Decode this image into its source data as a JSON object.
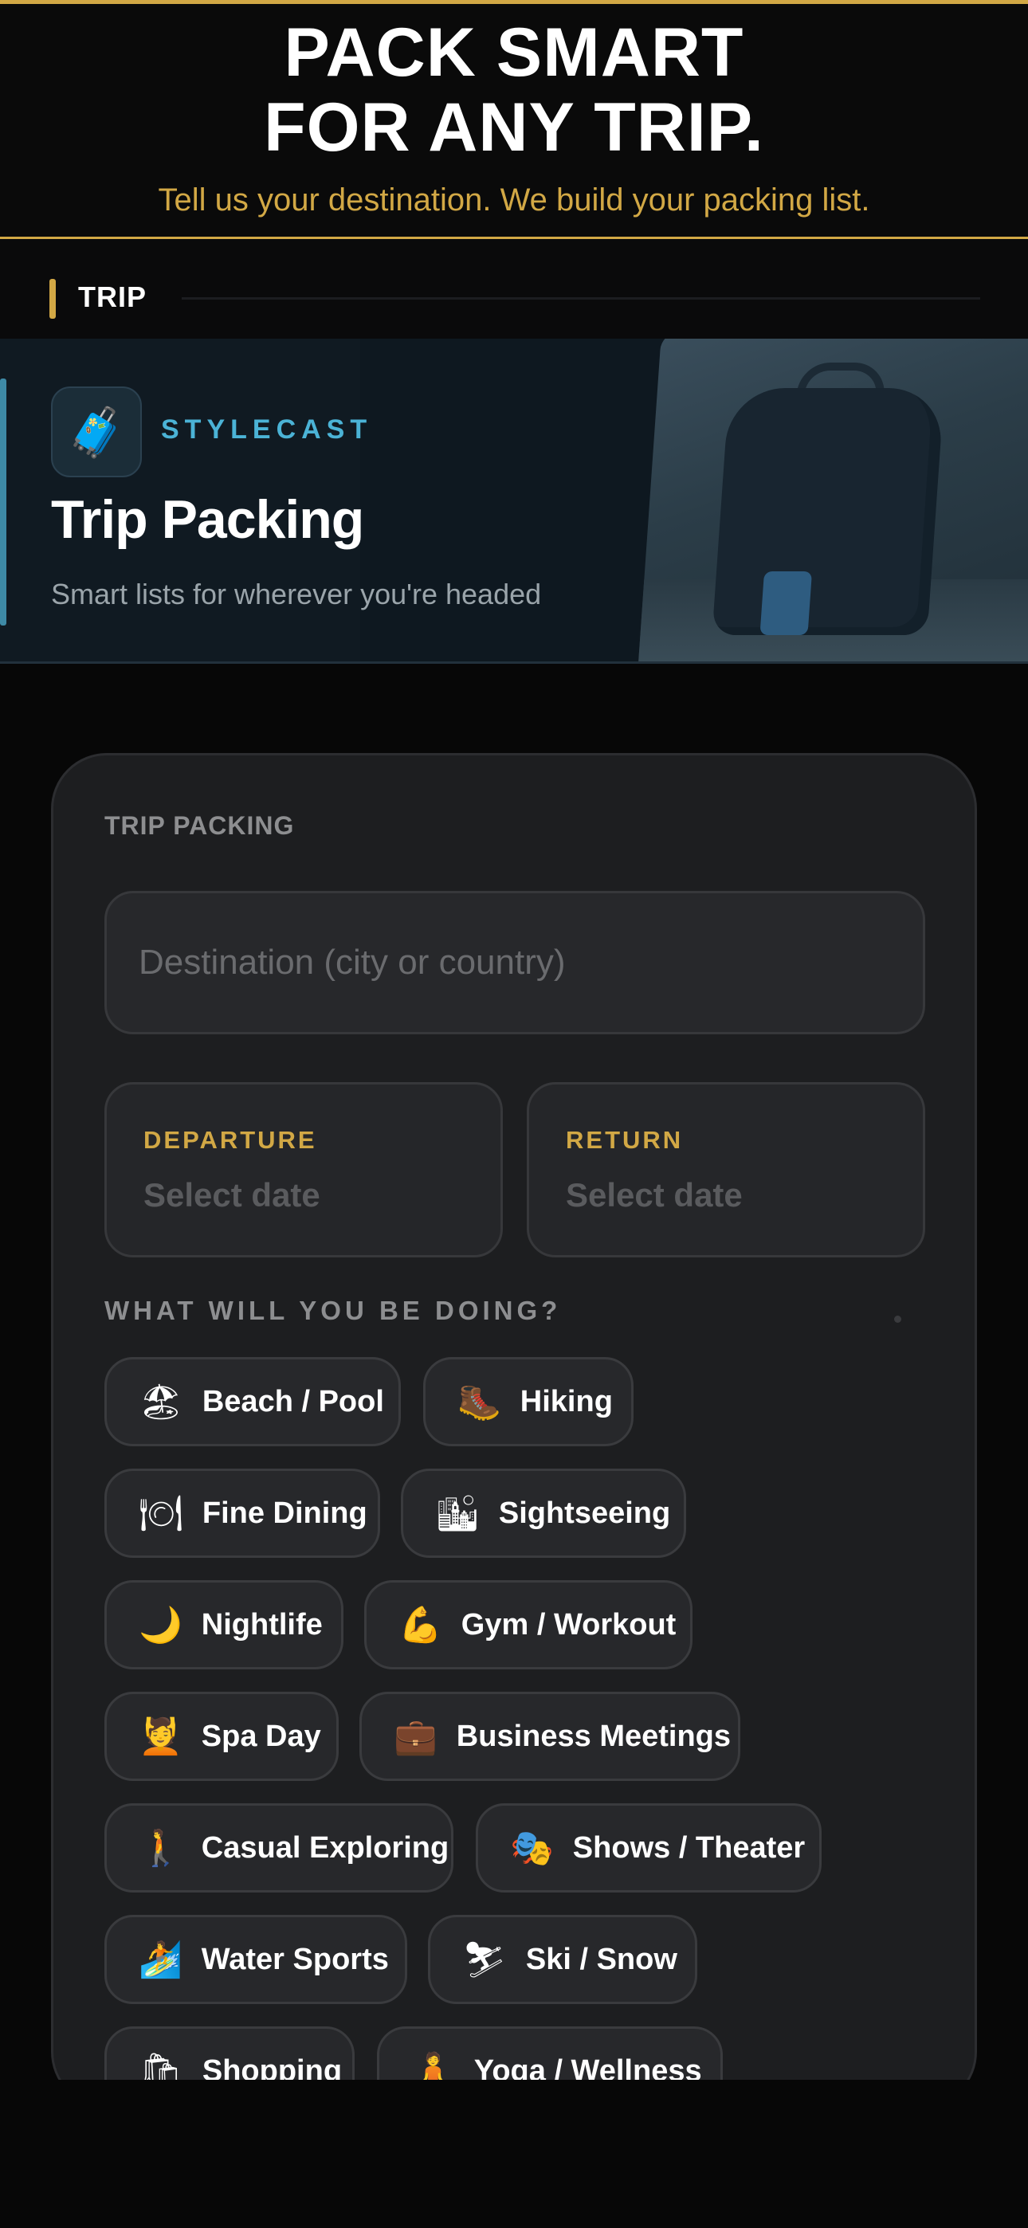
{
  "hero": {
    "title_line1": "PACK SMART",
    "title_line2": "FOR ANY TRIP.",
    "subtitle": "Tell us your destination. We build your packing list."
  },
  "section": {
    "label": "TRIP"
  },
  "banner": {
    "logo_icon": "luggage-icon",
    "brand": "STYLECAST",
    "title": "Trip Packing",
    "tagline": "Smart lists for wherever you're headed"
  },
  "form": {
    "card_title": "TRIP PACKING",
    "destination": {
      "value": "",
      "placeholder": "Destination (city or country)"
    },
    "departure": {
      "label": "DEPARTURE",
      "value": "Select date"
    },
    "return": {
      "label": "RETURN",
      "value": "Select date"
    },
    "activities_title": "WHAT WILL YOU BE DOING?",
    "activities": [
      {
        "emoji": "🏖",
        "label": "Beach / Pool"
      },
      {
        "emoji": "🥾",
        "label": "Hiking"
      },
      {
        "emoji": "🍽",
        "label": "Fine Dining"
      },
      {
        "emoji": "🏙",
        "label": "Sightseeing"
      },
      {
        "emoji": "🌙",
        "label": "Nightlife"
      },
      {
        "emoji": "💪",
        "label": "Gym / Workout"
      },
      {
        "emoji": "💆",
        "label": "Spa Day"
      },
      {
        "emoji": "💼",
        "label": "Business Meetings"
      },
      {
        "emoji": "🚶",
        "label": "Casual Exploring"
      },
      {
        "emoji": "🎭",
        "label": "Shows / Theater"
      },
      {
        "emoji": "🏄",
        "label": "Water Sports"
      },
      {
        "emoji": "⛷",
        "label": "Ski / Snow"
      },
      {
        "emoji": "🛍",
        "label": "Shopping"
      },
      {
        "emoji": "🧘",
        "label": "Yoga / Wellness"
      }
    ]
  },
  "colors": {
    "accent_gold": "#d2a845",
    "brand_blue": "#4bb3d6",
    "background": "#070707",
    "card": "#1d1e20"
  }
}
